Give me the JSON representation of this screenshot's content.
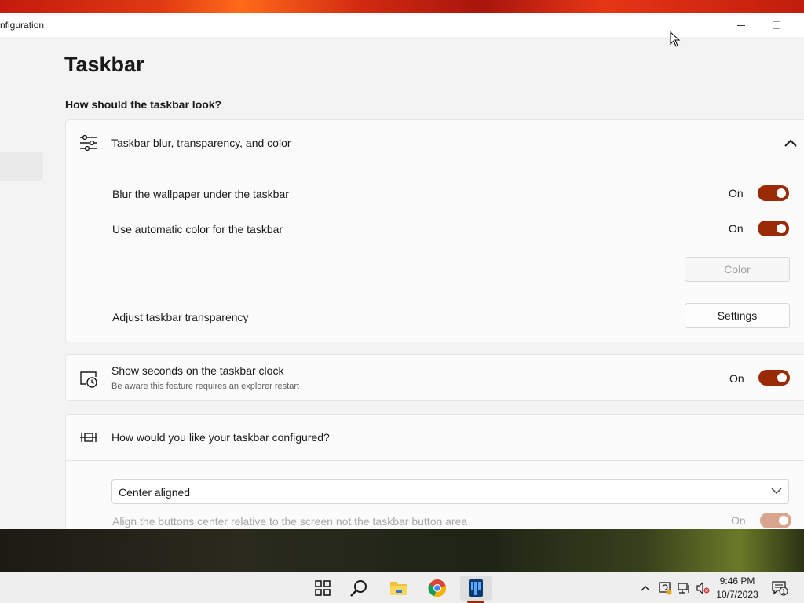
{
  "window": {
    "title": "nfiguration"
  },
  "page": {
    "title": "Taskbar",
    "section_heading": "How should the taskbar look?"
  },
  "blur_card": {
    "header": "Taskbar blur, transparency, and color",
    "header_icon": "sliders-icon",
    "rows": {
      "blur": {
        "label": "Blur the wallpaper under the taskbar",
        "state": "On"
      },
      "auto_color": {
        "label": "Use automatic color for the taskbar",
        "state": "On"
      },
      "color_button": "Color",
      "transparency": {
        "label": "Adjust taskbar transparency",
        "button": "Settings"
      }
    }
  },
  "seconds_card": {
    "label": "Show seconds on the taskbar clock",
    "sub": "Be aware this feature requires an explorer restart",
    "state": "On",
    "icon": "clock-monitor-icon"
  },
  "config_card": {
    "header": "How would you like your taskbar configured?",
    "header_icon": "taskbar-layout-icon",
    "dropdown_value": "Center aligned",
    "align_label": "Align the buttons center relative to the screen not the taskbar button area",
    "align_state": "On"
  },
  "taskbar": {
    "apps": [
      "start-icon",
      "search-icon",
      "file-explorer-icon",
      "chrome-icon",
      "app-icon"
    ],
    "time": "9:46 PM",
    "date": "10/7/2023",
    "notification_count": "1"
  },
  "colors": {
    "accent": "#9a2a06",
    "background": "#f3f3f3",
    "card": "#fbfbfb"
  }
}
